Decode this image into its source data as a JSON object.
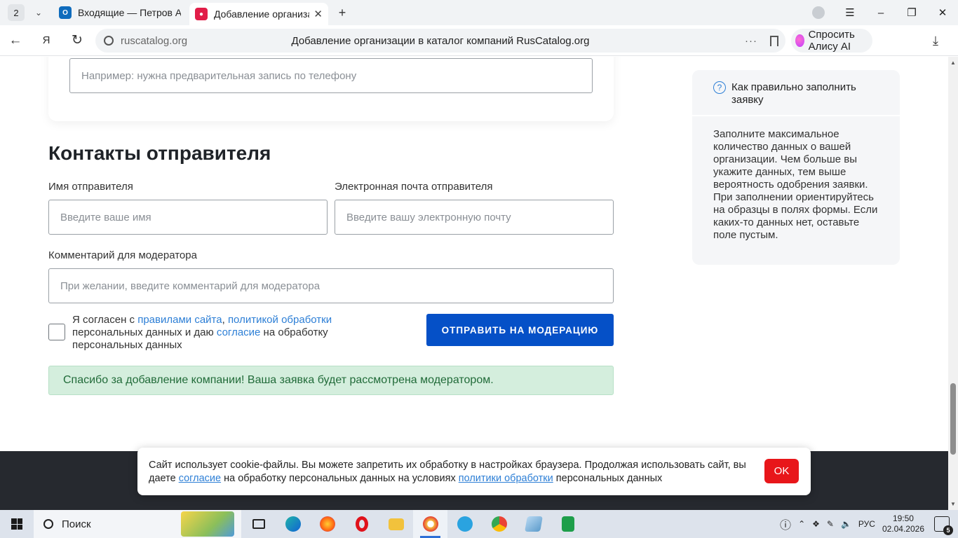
{
  "browser": {
    "tab_count": "2",
    "tabs": [
      {
        "title": "Входящие — Петров Анто",
        "favicon_color": "#0f6cbd"
      },
      {
        "title": "Добавление организац",
        "favicon_color": "#e11d48"
      }
    ],
    "domain": "ruscatalog.org",
    "page_title": "Добавление организации в каталог компаний RusCatalog.org",
    "alice_label": "Спросить Алису AI"
  },
  "form": {
    "notes_placeholder": "Например: нужна предварительная запись по телефону",
    "contacts_title": "Контакты отправителя",
    "name_label": "Имя отправителя",
    "name_placeholder": "Введите ваше имя",
    "email_label": "Электронная почта отправителя",
    "email_placeholder": "Введите вашу электронную почту",
    "comment_label": "Комментарий для модератора",
    "comment_placeholder": "При желании, введите комментарий для модератора",
    "consent": {
      "t1": "Я согласен с ",
      "link_rules": "правилами сайта",
      "t2": ", ",
      "link_policy": "политикой обработки",
      "t3": " персональных данных и даю ",
      "link_consent": "согласие",
      "t4": " на обработку персональных данных"
    },
    "submit_label": "ОТПРАВИТЬ НА МОДЕРАЦИЮ",
    "success_message": "Спасибо за добавление компании! Ваша заявка будет рассмотрена модератором."
  },
  "help": {
    "title": "Как правильно заполнить заявку",
    "body": "Заполните максимальное количество данных о вашей организации. Чем больше вы укажите данных, тем выше вероятность одобрения заявки. При заполнении ориентируйтесь на образцы в полях формы. Если каких-то данных нет, оставьте поле пустым."
  },
  "cookie": {
    "t1": "Сайт использует cookie-файлы. Вы можете запретить их обработку в настройках браузера. Продолжая использовать сайт, вы даете ",
    "link_consent": "согласие",
    "t2": " на обработку персональных данных на условиях ",
    "link_policy": "политики обработки",
    "t3": " персональных данных",
    "ok_label": "OK"
  },
  "taskbar": {
    "search_label": "Поиск",
    "language": "РУС",
    "time": "19:50",
    "date": "02.04.2026",
    "notifications": "5"
  },
  "colors": {
    "submit_button": "#0550c7",
    "link": "#2d7fd6",
    "success_bg": "#d4eedd",
    "cookie_ok": "#e8161a"
  }
}
